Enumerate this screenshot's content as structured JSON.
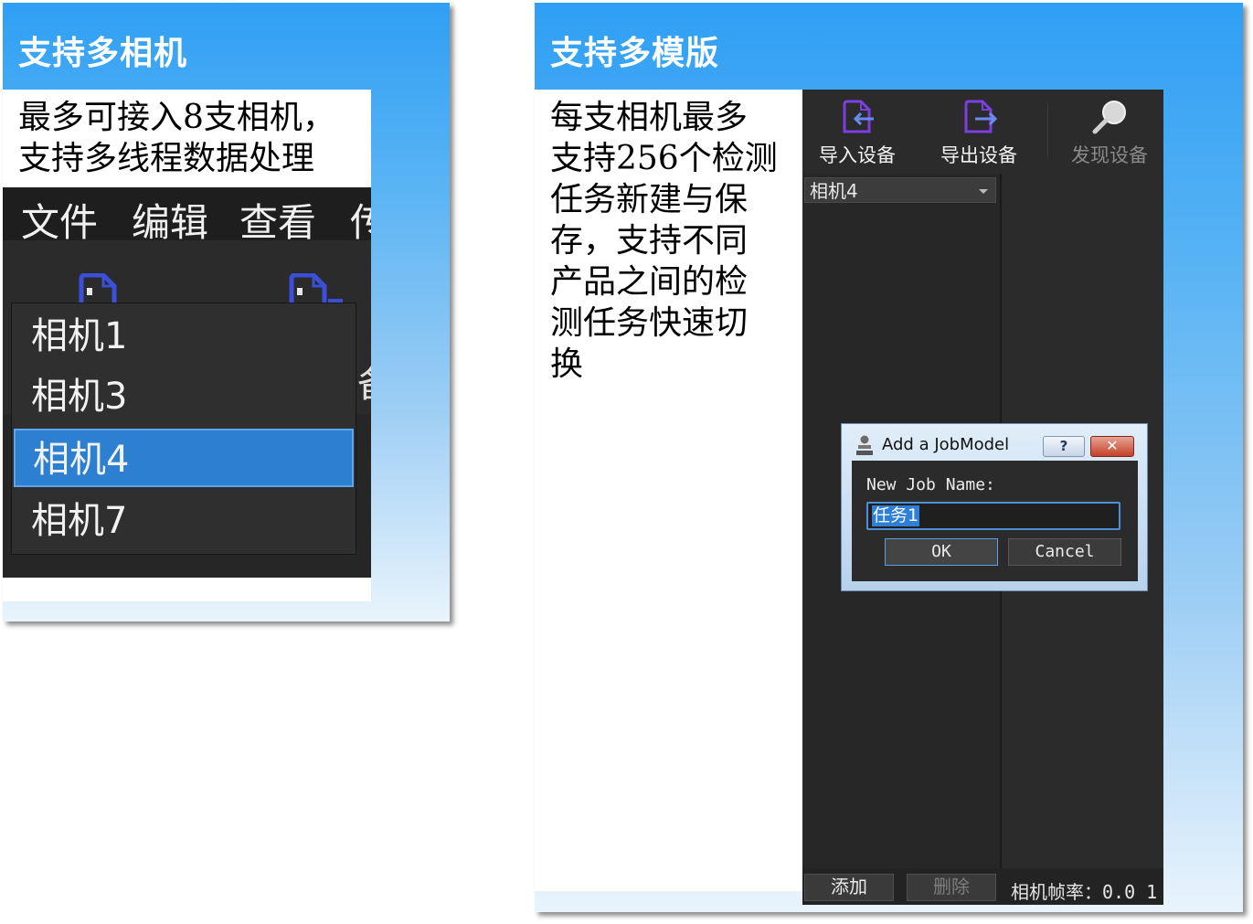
{
  "left_card": {
    "title": "支持多相机",
    "desc_lines": [
      "最多可接入8支相机，",
      "支持多线程数据处理"
    ],
    "menu": [
      "文件",
      "编辑",
      "查看",
      "传"
    ],
    "partial_label": "备",
    "camera_list": [
      "相机1",
      "相机3",
      "相机4",
      "相机7"
    ],
    "selected_camera": "相机4"
  },
  "right_card": {
    "title": "支持多模版",
    "desc_lines": [
      "每支相机最多",
      "支持256个检测",
      "任务新建与保",
      "存，支持不同",
      "产品之间的检",
      "测任务快速切",
      "换"
    ],
    "toolbar": [
      {
        "label": "导入设备",
        "icon": "import-icon",
        "enabled": true
      },
      {
        "label": "导出设备",
        "icon": "export-icon",
        "enabled": true
      },
      {
        "label": "发现设备",
        "icon": "magnifier-icon",
        "enabled": false
      }
    ],
    "camera_combo": "相机4",
    "bottom": {
      "add_label": "添加",
      "delete_label": "删除",
      "fps_text": "相机帧率：0.0 1"
    },
    "dialog": {
      "title": "Add a JobModel",
      "help": "?",
      "close": "✕",
      "field_label": "New Job Name:",
      "field_value": "任务1",
      "ok_label": "OK",
      "cancel_label": "Cancel"
    }
  },
  "colors": {
    "accent": "#2f9ff4",
    "selection": "#2d7fd2",
    "dark_bg": "#2b2b2b"
  }
}
